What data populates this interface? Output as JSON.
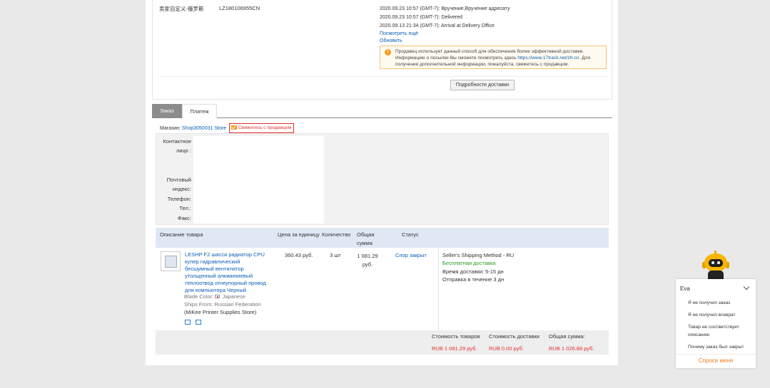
{
  "shipping": {
    "carrier": "卖家自定义-俄罗斯",
    "tracking_number": "LZ180106955CN",
    "events": [
      "2020.09.23 10:57 (GMT-7): Вручение,Вручение адресату",
      "2020.09.23 10:57 (GMT-7): Delivered",
      "2020.09.13 21:34 (GMT-7): Arrival at Delivery Office"
    ],
    "see_more": "Посмотреть ещё",
    "refresh": "Обновить",
    "notice_text": "Продавец использует данный способ для обеспечения более эффективной доставки. Информацию о посылке Вы сможете посмотреть здесь",
    "notice_link": "https://www.17track.net/zh-cn",
    "notice_suffix": ". Для получения дополнительной информации, пожалуйста, свяжитесь с продавцом.",
    "details_button": "Подробности доставки"
  },
  "tabs": {
    "order": "Заказ",
    "payment": "Платеж"
  },
  "store": {
    "label": "Магазин:",
    "name": "Shop3050031 Store",
    "contact_button": "Свяжитесь с продавцом"
  },
  "contact": {
    "person_line1": "Контактное",
    "person_line2": "лицо :",
    "postal_line1": "Почтовый",
    "postal_line2": "индекс:",
    "phone": "Телефон:",
    "tel": "Тел.:",
    "fax": "Факс:"
  },
  "table": {
    "col_description": "Описание товара",
    "col_unit_price": "Цена за единицу",
    "col_quantity": "Количество",
    "col_total_line1": "Общая",
    "col_total_line2": "сумма",
    "col_status": "Статус"
  },
  "item": {
    "title": "LESHP F2 шасси радиатор CPU кулер гидравлический бесшумный вентилятор утолщенный алюминиевый теплоотвод огнеупорный провод для компьютера Черный",
    "blade_color_label": "Blade Color:",
    "blade_color_value": "Japanese",
    "ships_from": "Ships From: Russian Federation",
    "store_name": "(MiKee Printer Supplies Store)",
    "unit_price": "360.43 руб.",
    "quantity": "3 шт",
    "total_line1": "1 081.29",
    "total_line2": "руб.",
    "status": "Спор закрыт",
    "shipping_method": "Seller's Shipping Method - RU",
    "free_shipping": "Бесплатная доставка",
    "delivery_time": "Время доставки:  5-15 дн",
    "dispatch_time": "Отправка в течение  3 дн"
  },
  "totals": {
    "goods_label": "Стоимость товаров",
    "goods_value": "RUB 1 081.29 руб.",
    "shipping_label": "Стоимость доставки",
    "shipping_value": "RUB 0.00 руб.",
    "total_label": "Общая сумма:",
    "total_value": "RUB 1 026.88 руб."
  },
  "chat": {
    "agent_name": "Eva",
    "items": [
      "Я не получил заказ",
      "Я не получил возврат",
      "Товар не соответствует описанию",
      "Почему заказ был закрыт"
    ],
    "ask_button": "Спроси меня"
  }
}
